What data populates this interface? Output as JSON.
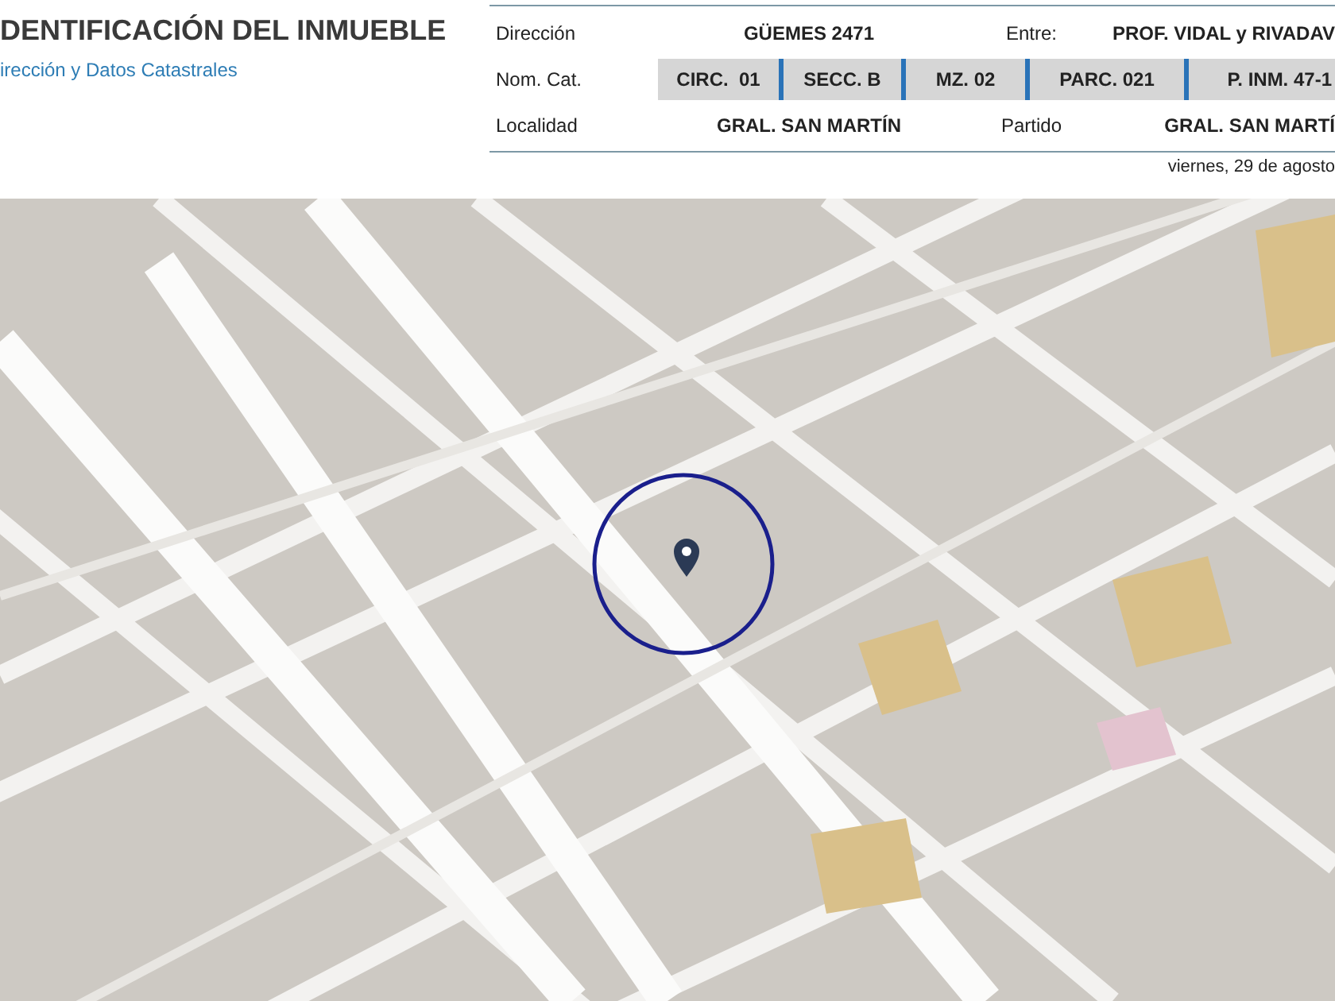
{
  "header": {
    "title": "DENTIFICACIÓN DEL INMUEBLE",
    "subtitle": "irección y Datos Catastrales"
  },
  "rows": [
    {
      "kind": "pair",
      "label": "Dirección",
      "value": "GÜEMES 2471",
      "label2": "Entre:",
      "value2": "PROF. VIDAL y RIVADAV"
    },
    {
      "kind": "cells",
      "label": "Nom. Cat.",
      "cells": [
        "CIRC.  01",
        "SECC. B",
        "MZ. 02",
        "PARC. 021",
        "P. INM. 47-1"
      ]
    },
    {
      "kind": "pair",
      "label": "Localidad",
      "value": "GRAL. SAN MARTÍN",
      "label2": "Partido",
      "value2": "GRAL. SAN MARTÍ"
    }
  ],
  "date": "viernes, 29 de agosto"
}
